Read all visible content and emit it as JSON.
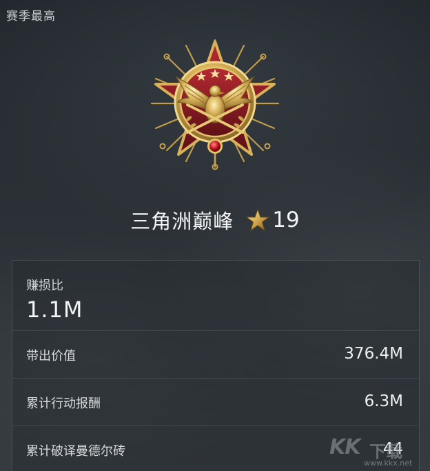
{
  "header": {
    "season_label": "赛季最高"
  },
  "rank": {
    "name": "三角洲巅峰",
    "level": "19",
    "star_icon": "star-icon",
    "medal_icon": "eagle-medal-icon"
  },
  "stats": {
    "main": {
      "label": "赚损比",
      "value": "1.1M"
    },
    "rows": [
      {
        "label": "带出价值",
        "value": "376.4M"
      },
      {
        "label": "累计行动报酬",
        "value": "6.3M"
      },
      {
        "label": "累计破译曼德尔砖",
        "value": "44"
      }
    ]
  },
  "watermark": {
    "brand": "KK",
    "cn": "下载",
    "url": "www.kkx.net"
  },
  "colors": {
    "background": "#2b3136",
    "gold": "#d8b25a",
    "medal_red": "#8e1c23",
    "text": "#f2f4f5"
  }
}
